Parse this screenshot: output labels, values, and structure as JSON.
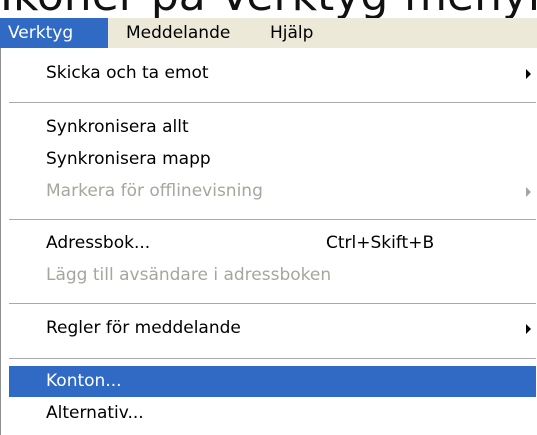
{
  "caption": "Ikoner på Verktyg-menyn",
  "menubar": {
    "items": [
      {
        "label": "Verktyg"
      },
      {
        "label": "Meddelande"
      },
      {
        "label": "Hjälp"
      }
    ]
  },
  "menu": {
    "items": [
      {
        "label": "Skicka och ta emot",
        "submenu": true,
        "enabled": true
      },
      {
        "label": "Synkronisera allt",
        "enabled": true
      },
      {
        "label": "Synkronisera mapp",
        "enabled": true
      },
      {
        "label": "Markera för offlinevisning",
        "submenu": true,
        "enabled": false
      },
      {
        "label": "Adressbok...",
        "shortcut": "Ctrl+Skift+B",
        "enabled": true
      },
      {
        "label": "Lägg till avsändare i adressboken",
        "enabled": false
      },
      {
        "label": "Regler för meddelande",
        "submenu": true,
        "enabled": true
      },
      {
        "label": "Konton...",
        "enabled": true,
        "highlighted": true
      },
      {
        "label": "Alternativ...",
        "enabled": true
      }
    ]
  },
  "colors": {
    "highlight": "#316ac5",
    "disabled_text": "#a7a69c",
    "menubar_background": "#ece9d8"
  }
}
